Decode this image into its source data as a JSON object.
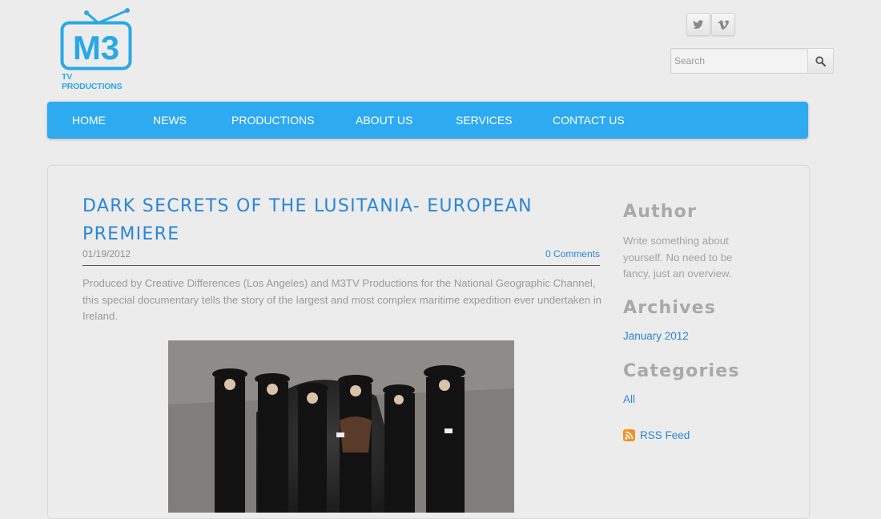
{
  "logo": {
    "mark": "M3",
    "subtitle": "TV PRODUCTIONS",
    "color": "#2aa8e6"
  },
  "social": {
    "twitter_icon": "twitter-icon",
    "vimeo_icon": "vimeo-icon",
    "twitter_glyph": "t",
    "vimeo_glyph": "v"
  },
  "search": {
    "placeholder": "Search"
  },
  "nav": {
    "items": [
      {
        "label": "HOME"
      },
      {
        "label": "NEWS"
      },
      {
        "label": "PRODUCTIONS"
      },
      {
        "label": "ABOUT US"
      },
      {
        "label": "SERVICES"
      },
      {
        "label": "CONTACT US"
      }
    ],
    "color": "#2eaaf1"
  },
  "post": {
    "title": "DARK SECRETS OF THE LUSITANIA- EUROPEAN PREMIERE",
    "date": "01/19/2012",
    "comments": "0 Comments",
    "body": "Produced by Creative Differences (Los Angeles) and M3TV Productions for the National Geographic Channel, this special documentary tells the story of the largest and most complex maritime expedition ever undertaken in Ireland."
  },
  "sidebar": {
    "author_heading": "Author",
    "author_text": "Write something about yourself. No need to be fancy, just an overview.",
    "archives_heading": "Archives",
    "archives": [
      {
        "label": "January 2012"
      }
    ],
    "categories_heading": "Categories",
    "categories": [
      {
        "label": "All"
      }
    ],
    "rss_label": "RSS Feed"
  }
}
